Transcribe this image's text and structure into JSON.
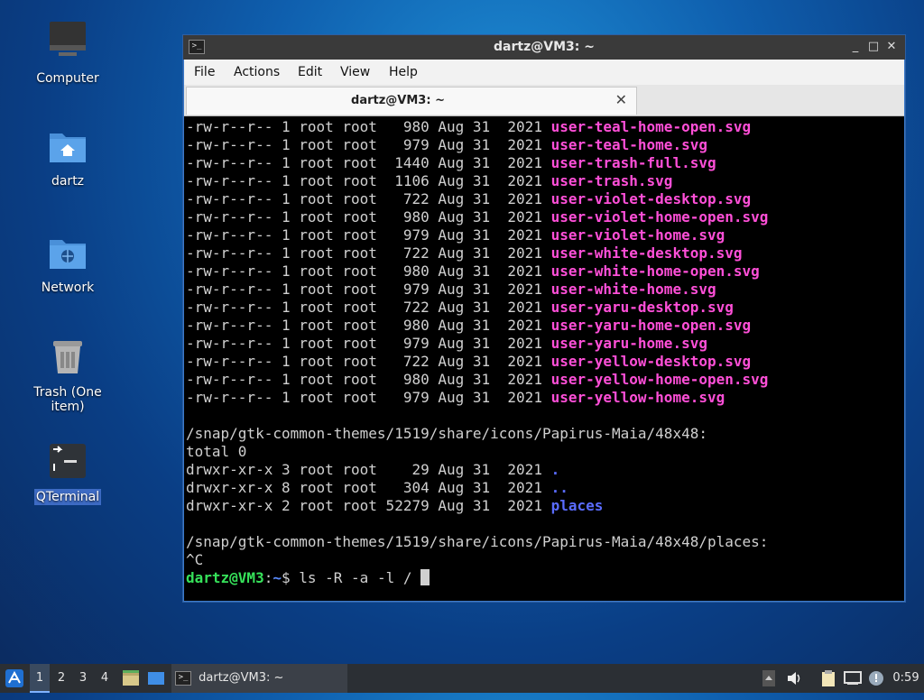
{
  "desktop": {
    "icons": [
      {
        "label": "Computer"
      },
      {
        "label": "dartz"
      },
      {
        "label": "Network"
      },
      {
        "label": "Trash (One item)"
      },
      {
        "label": "QTerminal"
      }
    ]
  },
  "window": {
    "title": "dartz@VM3: ~",
    "controls": {
      "minimize": "_",
      "maximize": "□",
      "close": "✕"
    },
    "menu": [
      "File",
      "Actions",
      "Edit",
      "View",
      "Help"
    ],
    "tab": {
      "label": "dartz@VM3: ~",
      "close": "✕"
    }
  },
  "terminal": {
    "listing": [
      {
        "meta": "-rw-r--r-- 1 root root   980 Aug 31  2021 ",
        "name": "user-teal-home-open.svg"
      },
      {
        "meta": "-rw-r--r-- 1 root root   979 Aug 31  2021 ",
        "name": "user-teal-home.svg"
      },
      {
        "meta": "-rw-r--r-- 1 root root  1440 Aug 31  2021 ",
        "name": "user-trash-full.svg"
      },
      {
        "meta": "-rw-r--r-- 1 root root  1106 Aug 31  2021 ",
        "name": "user-trash.svg"
      },
      {
        "meta": "-rw-r--r-- 1 root root   722 Aug 31  2021 ",
        "name": "user-violet-desktop.svg"
      },
      {
        "meta": "-rw-r--r-- 1 root root   980 Aug 31  2021 ",
        "name": "user-violet-home-open.svg"
      },
      {
        "meta": "-rw-r--r-- 1 root root   979 Aug 31  2021 ",
        "name": "user-violet-home.svg"
      },
      {
        "meta": "-rw-r--r-- 1 root root   722 Aug 31  2021 ",
        "name": "user-white-desktop.svg"
      },
      {
        "meta": "-rw-r--r-- 1 root root   980 Aug 31  2021 ",
        "name": "user-white-home-open.svg"
      },
      {
        "meta": "-rw-r--r-- 1 root root   979 Aug 31  2021 ",
        "name": "user-white-home.svg"
      },
      {
        "meta": "-rw-r--r-- 1 root root   722 Aug 31  2021 ",
        "name": "user-yaru-desktop.svg"
      },
      {
        "meta": "-rw-r--r-- 1 root root   980 Aug 31  2021 ",
        "name": "user-yaru-home-open.svg"
      },
      {
        "meta": "-rw-r--r-- 1 root root   979 Aug 31  2021 ",
        "name": "user-yaru-home.svg"
      },
      {
        "meta": "-rw-r--r-- 1 root root   722 Aug 31  2021 ",
        "name": "user-yellow-desktop.svg"
      },
      {
        "meta": "-rw-r--r-- 1 root root   980 Aug 31  2021 ",
        "name": "user-yellow-home-open.svg"
      },
      {
        "meta": "-rw-r--r-- 1 root root   979 Aug 31  2021 ",
        "name": "user-yellow-home.svg"
      }
    ],
    "path1": "/snap/gtk-common-themes/1519/share/icons/Papirus-Maia/48x48:",
    "total": "total 0",
    "dirs": [
      {
        "meta": "drwxr-xr-x 3 root root    29 Aug 31  2021 ",
        "name": "."
      },
      {
        "meta": "drwxr-xr-x 8 root root   304 Aug 31  2021 ",
        "name": ".."
      },
      {
        "meta": "drwxr-xr-x 2 root root 52279 Aug 31  2021 ",
        "name": "places"
      }
    ],
    "path2": "/snap/gtk-common-themes/1519/share/icons/Papirus-Maia/48x48/places:",
    "interrupt": "^C",
    "prompt_user": "dartz@VM3",
    "prompt_sep": ":",
    "prompt_path": "~",
    "prompt_dollar": "$ ",
    "command": "ls -R -a -l / "
  },
  "taskbar": {
    "workspaces": [
      "1",
      "2",
      "3",
      "4"
    ],
    "task_label": "dartz@VM3: ~",
    "clock": "0:59"
  },
  "colors": {
    "filename": "#ff4fd8",
    "directory": "#5a6cff",
    "prompt_user": "#36e25a",
    "selection": "#3d6bc4"
  }
}
